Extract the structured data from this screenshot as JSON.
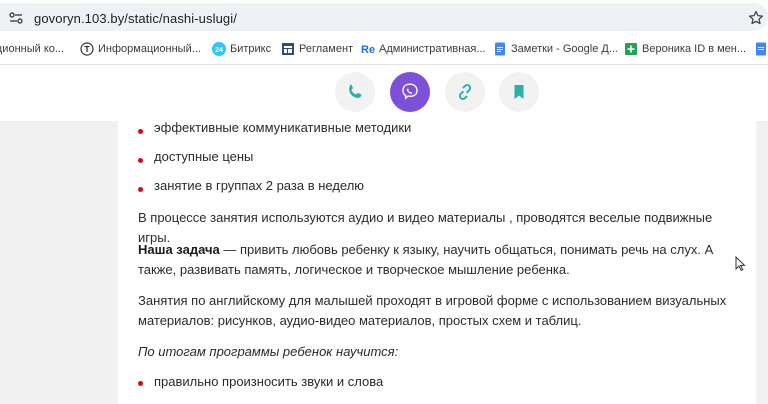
{
  "browser": {
    "url": "govoryn.103.by/static/nashi-uslugi/"
  },
  "bookmarks": [
    {
      "label": "ционный ко...",
      "icon": "page-icon"
    },
    {
      "label": "Информационный...",
      "icon": "t-circle-icon"
    },
    {
      "label": "Битрикс",
      "icon": "bitrix24-icon"
    },
    {
      "label": "Регламент",
      "icon": "layout-icon"
    },
    {
      "label": "Административная...",
      "icon": "re-icon"
    },
    {
      "label": "Заметки - Google Д...",
      "icon": "google-docs-icon"
    },
    {
      "label": "Вероника ID в мен...",
      "icon": "plus-square-icon"
    }
  ],
  "share": {
    "buttons": [
      "phone-icon",
      "viber-icon",
      "link-icon",
      "bookmark-icon"
    ],
    "colors": {
      "accent": "#2ab0a8",
      "viber": "#7d50d9"
    }
  },
  "article": {
    "list1": [
      "эффективные коммуникативные методики",
      "доступные цены",
      "занятие в группах 2 раза в неделю"
    ],
    "p1": "В процессе занятия используются аудио и видео материалы , проводятся веселые подвижные игры.",
    "p2_bold": "Наша задача",
    "p2_line1": " — привить любовь ребенку к языку, научить общаться, понимать речь на слух. А",
    "p2_line2": "также, развивать память, логическое и творческое мышление ребенка.",
    "p3_line1": "Занятия по английскому для малышей проходят в игровой форме с использованием визуальных",
    "p3_line2": "материалов: рисунков, аудио-видео материалов, простых схем и таблиц.",
    "p4": "По итогам программы ребенок научится:",
    "list2": [
      "правильно произносить звуки и слова"
    ],
    "bullet_color": "#e2001a"
  }
}
